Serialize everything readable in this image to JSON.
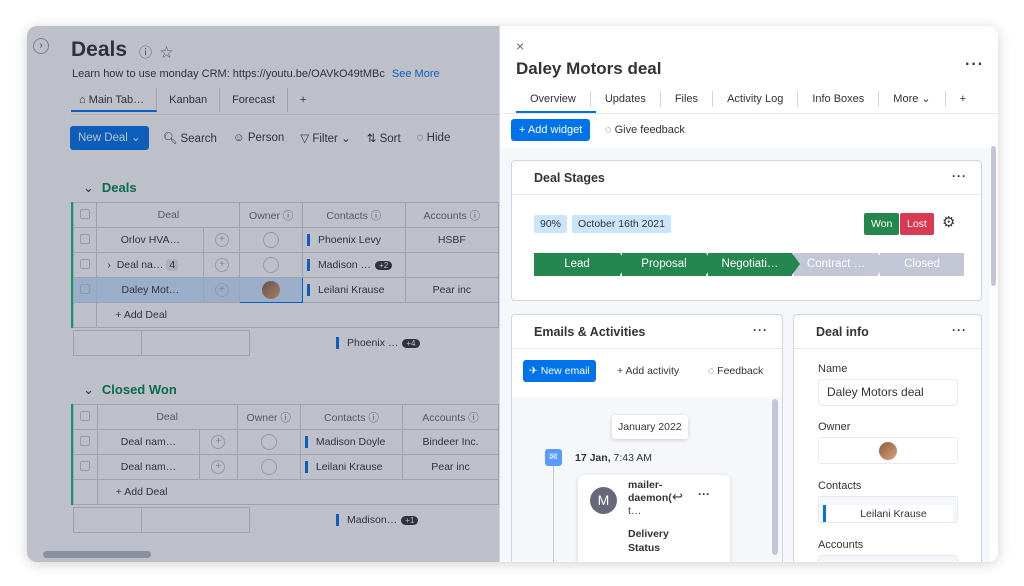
{
  "board": {
    "title": "Deals",
    "title_icons": "ⓘ☆",
    "description": "Learn how to use monday CRM: https://youtu.be/OAVkO49tMBc",
    "see_more": "See More",
    "views": [
      "⌂ Main Tab…",
      "Kanban",
      "Forecast",
      "+"
    ],
    "toolbar": {
      "new_deal": "New Deal ⌄",
      "search": "🔍︎ Search",
      "person": "☺ Person",
      "filter": "▽ Filter ⌄",
      "sort": "⇅ Sort",
      "hide": "◌ Hide"
    },
    "collapse": "›",
    "headers": {
      "deal": "Deal",
      "owner": "Owner ⓘ",
      "contacts": "Contacts ⓘ",
      "accounts": "Accounts ⓘ"
    },
    "groups": [
      {
        "name": "Deals",
        "chevron": "⌄",
        "rows": [
          {
            "deal": "Orlov HVA…",
            "contact": "Phoenix Levy",
            "account": "HSBF"
          },
          {
            "deal": "Deal na…",
            "count": "4",
            "expand": "›",
            "contact": "Madison …",
            "contact_badge": "+2",
            "account": ""
          },
          {
            "deal": "Daley Mot…",
            "contact": "Leilani Krause",
            "account": "Pear inc"
          }
        ],
        "add": "+ Add Deal",
        "summary": "Phoenix …",
        "summary_badge": "+4"
      },
      {
        "name": "Closed Won",
        "chevron": "⌄",
        "rows": [
          {
            "deal": "Deal nam…",
            "contact": "Madison Doyle",
            "account": "Bindeer Inc."
          },
          {
            "deal": "Deal nam…",
            "contact": "Leilani Krause",
            "account": "Pear inc"
          }
        ],
        "add": "+ Add Deal",
        "summary": "Madison…",
        "summary_badge": "+1"
      }
    ]
  },
  "panel": {
    "close": "×",
    "title": "Daley Motors deal",
    "more": "···",
    "tabs": [
      "Overview",
      "Updates",
      "Files",
      "Activity Log",
      "Info Boxes",
      "More ⌄",
      "+"
    ],
    "add_widget": "+  Add widget",
    "give_feedback": "◌  Give feedback",
    "deal_stages": {
      "title": "Deal Stages",
      "more": "···",
      "probability": "90%",
      "date": "October 16th 2021",
      "won": "Won",
      "lost": "Lost",
      "settings_icon": "⚙",
      "stages": [
        {
          "label": "Lead",
          "done": true
        },
        {
          "label": "Proposal",
          "done": true
        },
        {
          "label": "Negotiati…",
          "done": true
        },
        {
          "label": "Contract …",
          "done": false
        },
        {
          "label": "Closed",
          "done": false
        }
      ]
    },
    "emails": {
      "title": "Emails & Activities",
      "more": "···",
      "new_email": "✈  New email",
      "add_activity": "+  Add activity",
      "feedback": "◌  Feedback",
      "date_chip": "January 2022",
      "mail_icon": "✉",
      "entry_date": "17 Jan,",
      "entry_time": "7:43 AM",
      "avatar_letter": "M",
      "sender_line1": "mailer-",
      "sender_line2": "daemon(",
      "sender_line3": "t…",
      "reply_icon": "↩",
      "entry_more": "···",
      "subject_line1": "Delivery",
      "subject_line2": "Status"
    },
    "deal_info": {
      "title": "Deal info",
      "more": "···",
      "name_label": "Name",
      "name_value": "Daley Motors deal",
      "owner_label": "Owner",
      "contacts_label": "Contacts",
      "contacts_value": "Leilani Krause",
      "accounts_label": "Accounts"
    }
  },
  "colors": {
    "accent": "#0073ea",
    "group_green": "#00854d",
    "stage_done": "#258750",
    "stage_todo": "#c3c6d4",
    "won": "#258750",
    "lost": "#d83a52"
  }
}
